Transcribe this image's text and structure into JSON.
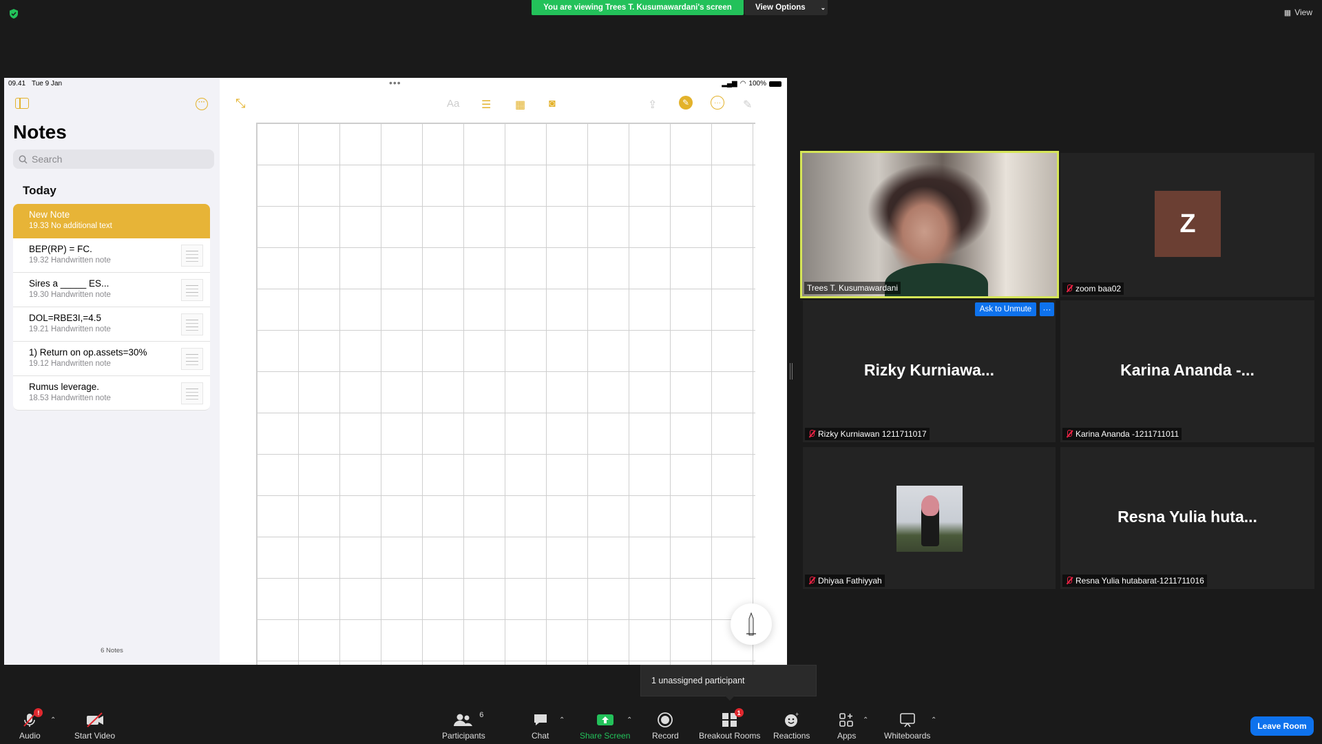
{
  "banner": {
    "viewing_text": "You are viewing Trees T. Kusumawardani's screen",
    "view_options_label": "View Options",
    "view_label": "View"
  },
  "ipad": {
    "time": "09.41",
    "date": "Tue 9 Jan",
    "battery": "100%",
    "notes_title": "Notes",
    "search_placeholder": "Search",
    "section": "Today",
    "notes": [
      {
        "title": "New Note",
        "subtitle": "19.33  No additional text"
      },
      {
        "title": "BEP(RP) = FC.",
        "subtitle": "19.32  Handwritten note"
      },
      {
        "title": "Sires a _____ ES...",
        "subtitle": "19.30  Handwritten note"
      },
      {
        "title": "DOL=RBE3I,=4.5",
        "subtitle": "19.21  Handwritten note"
      },
      {
        "title": "1) Return on op.assets=30%",
        "subtitle": "19.12  Handwritten note"
      },
      {
        "title": "Rumus leverage.",
        "subtitle": "18.53  Handwritten note"
      }
    ],
    "count_label": "6 Notes",
    "format_label": "Aa"
  },
  "gallery": {
    "tiles": [
      {
        "name": "Trees T. Kusumawardani"
      },
      {
        "name": "zoom baa02",
        "avatar_letter": "Z"
      },
      {
        "name": "Rizky Kurniawan 1211711017",
        "display": "Rizky  Kurniawa..."
      },
      {
        "name": "Karina Ananda -1211711011",
        "display": "Karina Ananda -..."
      },
      {
        "name": "Dhiyaa Fathiyyah"
      },
      {
        "name": "Resna Yulia hutabarat-1211711016",
        "display": "Resna Yulia huta..."
      }
    ],
    "ask_unmute": "Ask to Unmute",
    "more": "···"
  },
  "tooltip": "1 unassigned participant",
  "toolbar": {
    "audio": "Audio",
    "start_video": "Start Video",
    "participants": "Participants",
    "participants_count": "6",
    "chat": "Chat",
    "share_screen": "Share Screen",
    "record": "Record",
    "breakout_rooms": "Breakout Rooms",
    "breakout_badge": "1",
    "audio_badge": "!",
    "reactions": "Reactions",
    "apps": "Apps",
    "whiteboards": "Whiteboards",
    "leave_room": "Leave Room"
  },
  "colors": {
    "zoom_blue": "#0e72ed",
    "share_green": "#23c15a",
    "notes_yellow": "#e7b437",
    "speaker_border": "#d6e657"
  }
}
